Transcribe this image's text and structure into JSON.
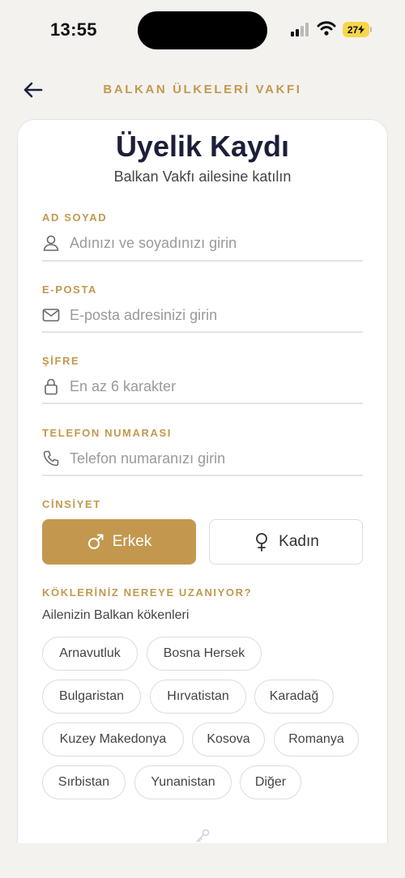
{
  "status": {
    "time": "13:55",
    "battery": "27"
  },
  "header": {
    "brand": "BALKAN ÜLKELERİ VAKFI"
  },
  "form": {
    "title": "Üyelik Kaydı",
    "subtitle": "Balkan Vakfı ailesine katılın",
    "fields": [
      {
        "label": "AD SOYAD",
        "placeholder": "Adınızı ve soyadınızı girin",
        "icon": "user-icon"
      },
      {
        "label": "E-POSTA",
        "placeholder": "E-posta adresinizi girin",
        "icon": "mail-icon"
      },
      {
        "label": "ŞİFRE",
        "placeholder": "En az 6 karakter",
        "icon": "lock-icon"
      },
      {
        "label": "TELEFON NUMARASI",
        "placeholder": "Telefon numaranızı girin",
        "icon": "phone-icon"
      }
    ],
    "gender": {
      "label": "CİNSİYET",
      "options": [
        "Erkek",
        "Kadın"
      ],
      "selected": "Erkek"
    },
    "roots": {
      "label": "KÖKLERİNİZ NEREYE UZANIYOR?",
      "hint": "Ailenizin Balkan kökenleri",
      "options": [
        "Arnavutluk",
        "Bosna Hersek",
        "Bulgaristan",
        "Hırvatistan",
        "Karadağ",
        "Kuzey Makedonya",
        "Kosova",
        "Romanya",
        "Sırbistan",
        "Yunanistan",
        "Diğer"
      ]
    }
  },
  "colors": {
    "accent": "#c3984e",
    "title": "#1c1f3a",
    "background": "#f3f2ef"
  }
}
